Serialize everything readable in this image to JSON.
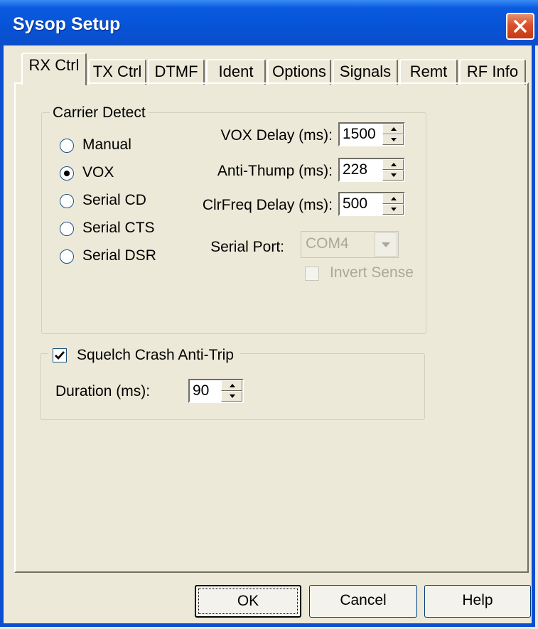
{
  "window": {
    "title": "Sysop Setup",
    "close_label": "close"
  },
  "tabs": [
    {
      "label": "RX Ctrl",
      "active": true
    },
    {
      "label": "TX Ctrl",
      "active": false
    },
    {
      "label": "DTMF",
      "active": false
    },
    {
      "label": "Ident",
      "active": false
    },
    {
      "label": "Options",
      "active": false
    },
    {
      "label": "Signals",
      "active": false
    },
    {
      "label": "Remt",
      "active": false
    },
    {
      "label": "RF Info",
      "active": false
    }
  ],
  "carrier_detect": {
    "group_label": "Carrier Detect",
    "options": [
      {
        "label": "Manual",
        "selected": false
      },
      {
        "label": "VOX",
        "selected": true
      },
      {
        "label": "Serial CD",
        "selected": false
      },
      {
        "label": "Serial CTS",
        "selected": false
      },
      {
        "label": "Serial DSR",
        "selected": false
      }
    ],
    "vox_delay": {
      "label": "VOX Delay (ms):",
      "value": "1500"
    },
    "anti_thump": {
      "label": "Anti-Thump (ms):",
      "value": "228"
    },
    "clrfreq_delay": {
      "label": "ClrFreq Delay (ms):",
      "value": "500"
    },
    "serial_port": {
      "label": "Serial Port:",
      "value": "COM4"
    },
    "invert_sense": {
      "label": "Invert Sense",
      "checked": false
    }
  },
  "squelch": {
    "label": "Squelch Crash Anti-Trip",
    "checked": true,
    "duration": {
      "label": "Duration (ms):",
      "value": "90"
    }
  },
  "buttons": {
    "ok": "OK",
    "cancel": "Cancel",
    "help": "Help"
  }
}
